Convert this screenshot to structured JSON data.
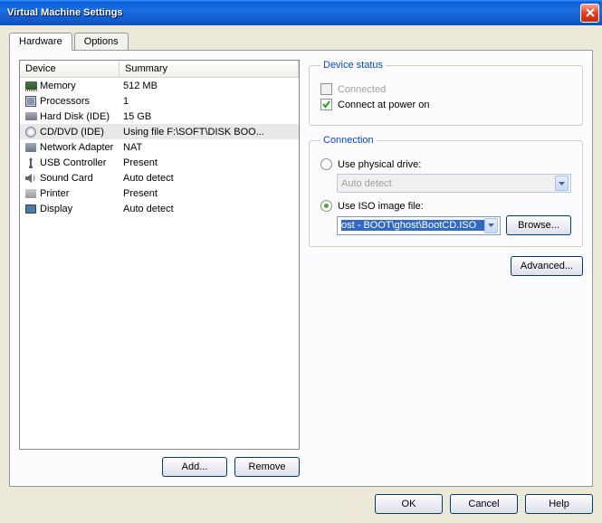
{
  "window": {
    "title": "Virtual Machine Settings"
  },
  "tabs": {
    "hardware": "Hardware",
    "options": "Options"
  },
  "device_table": {
    "col_device": "Device",
    "col_summary": "Summary",
    "rows": [
      {
        "icon": "memory-icon",
        "name": "Memory",
        "summary": "512 MB"
      },
      {
        "icon": "processors-icon",
        "name": "Processors",
        "summary": "1"
      },
      {
        "icon": "harddisk-icon",
        "name": "Hard Disk (IDE)",
        "summary": "15 GB"
      },
      {
        "icon": "cddvd-icon",
        "name": "CD/DVD (IDE)",
        "summary": "Using file F:\\SOFT\\DISK BOO..."
      },
      {
        "icon": "network-icon",
        "name": "Network Adapter",
        "summary": "NAT"
      },
      {
        "icon": "usb-icon",
        "name": "USB Controller",
        "summary": "Present"
      },
      {
        "icon": "sound-icon",
        "name": "Sound Card",
        "summary": "Auto detect"
      },
      {
        "icon": "printer-icon",
        "name": "Printer",
        "summary": "Present"
      },
      {
        "icon": "display-icon",
        "name": "Display",
        "summary": "Auto detect"
      }
    ],
    "selected_index": 3
  },
  "left_buttons": {
    "add": "Add...",
    "remove": "Remove"
  },
  "device_status": {
    "legend": "Device status",
    "connected": "Connected",
    "connect_power_on": "Connect at power on"
  },
  "connection": {
    "legend": "Connection",
    "physical": "Use physical drive:",
    "physical_value": "Auto detect",
    "iso": "Use ISO image file:",
    "iso_value": "ost - BOOT\\ghost\\BootCD.ISO",
    "browse": "Browse..."
  },
  "advanced": "Advanced...",
  "footer": {
    "ok": "OK",
    "cancel": "Cancel",
    "help": "Help"
  }
}
